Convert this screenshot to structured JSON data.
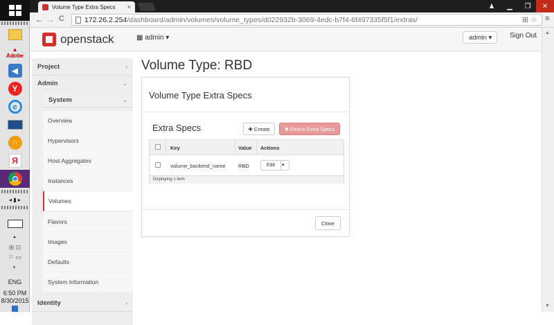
{
  "browser": {
    "tab_title": "Volume Type Extra Specs",
    "tab_close": "×",
    "url_host": "172.26.2.254",
    "url_path": "/dashboard/admin/volumes/volume_types/d022932b-3069-4edc-b7f4-6f497335f5f1/extras/",
    "back": "←",
    "forward": "→",
    "reload": "C",
    "window_min": "▁",
    "window_max": "❐",
    "window_close": "✕",
    "user_glyph": "♟"
  },
  "header": {
    "brand": "openstack",
    "project_label": "admin ▾",
    "user_label": "admin ▾",
    "sign_out": "Sign Out"
  },
  "sidebar": {
    "panels": [
      {
        "label": "Project",
        "caret": "›"
      },
      {
        "label": "Admin",
        "caret": "⌄"
      }
    ],
    "system": {
      "label": "System",
      "caret": "⌄"
    },
    "links": [
      "Overview",
      "Hypervisors",
      "Host Aggregates",
      "Instances",
      "Volumes",
      "Flavors",
      "Images",
      "Defaults",
      "System Information"
    ],
    "active": "Volumes",
    "identity": {
      "label": "Identity",
      "caret": "›"
    }
  },
  "main": {
    "page_title": "Volume Type: RBD",
    "modal_title": "Volume Type Extra Specs",
    "section_title": "Extra Specs",
    "create_label": "✚ Create",
    "delete_label": "✖ Delete Extra Specs",
    "columns": [
      "Key",
      "Value",
      "Actions"
    ],
    "rows": [
      {
        "key": "volume_backend_name",
        "value": "RBD",
        "action": "Edit"
      }
    ],
    "footer": "Displaying 1 item",
    "close_label": "Close"
  },
  "taskbar": {
    "language": "ENG",
    "time": "6:50 PM",
    "date": "8/30/2015"
  },
  "colors": {
    "accent": "#d32f2f",
    "delete_button": "#e89a9a"
  }
}
